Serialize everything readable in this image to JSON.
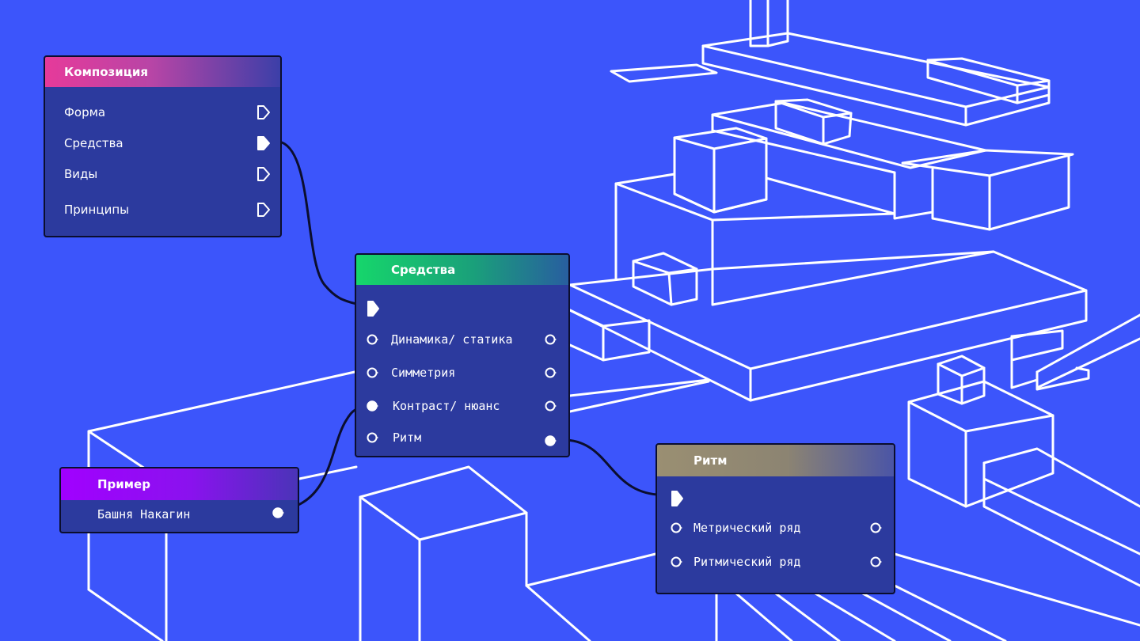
{
  "nodes": {
    "kompozitsiya": {
      "title": "Композиция",
      "items": [
        {
          "label": "Форма",
          "port": "exec-out-hollow"
        },
        {
          "label": "Средства",
          "port": "exec-out-filled"
        },
        {
          "label": "Виды",
          "port": "exec-out-hollow"
        },
        {
          "label": "Принципы",
          "port": "exec-out-hollow"
        }
      ]
    },
    "sredstva": {
      "title": "Средства",
      "items": [
        {
          "label": "Динамика/ статика"
        },
        {
          "label": "Симметрия"
        },
        {
          "label": "Контраст/ нюанс"
        },
        {
          "label": "Ритм"
        }
      ]
    },
    "primer": {
      "title": "Пример",
      "items": [
        {
          "label": "Башня Накагин"
        }
      ]
    },
    "ritm": {
      "title": "Ритм",
      "items": [
        {
          "label": "Метрический ряд"
        },
        {
          "label": "Ритмический ряд"
        }
      ]
    }
  },
  "colors": {
    "background": "#3c55fb",
    "node_body": "#2c3a9e",
    "node_border": "#0b0e2e",
    "wire": "#0b0e2e",
    "line_art": "#ffffff",
    "header_kompozitsiya": "#e63a9a",
    "header_sredstva": "#16d66b",
    "header_primer": "#a100ff",
    "header_ritm": "#9a8f72"
  }
}
